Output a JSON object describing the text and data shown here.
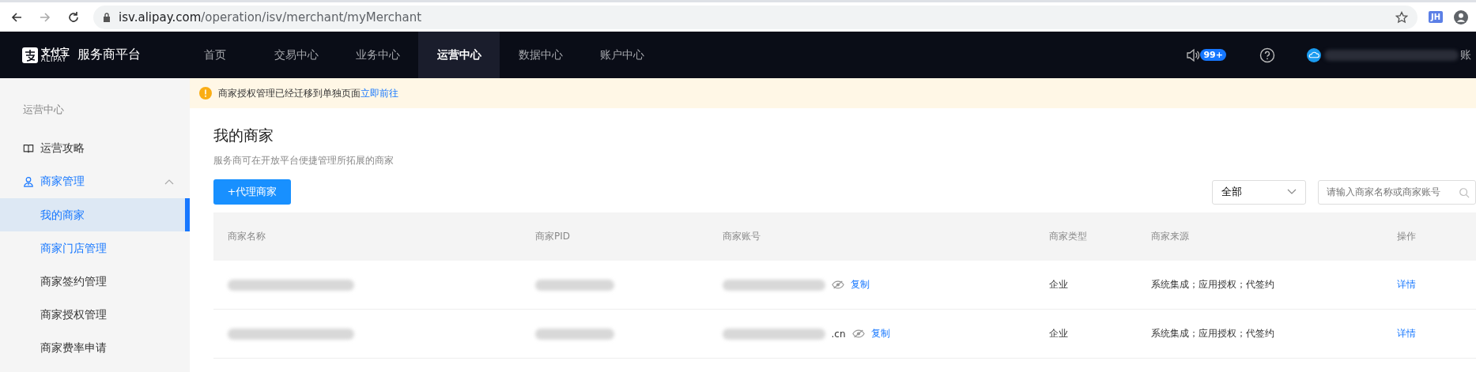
{
  "browser": {
    "url_host": "isv.alipay.com",
    "url_path": "/operation/isv/merchant/myMerchant",
    "extension_badge": "JH"
  },
  "header": {
    "logo_text": "支付宝",
    "logo_sub": "ALIPAY",
    "platform": "服务商平台",
    "nav": [
      {
        "label": "首页",
        "selected": false
      },
      {
        "label": "交易中心",
        "selected": false
      },
      {
        "label": "业务中心",
        "selected": false
      },
      {
        "label": "运营中心",
        "selected": true
      },
      {
        "label": "数据中心",
        "selected": false
      },
      {
        "label": "账户中心",
        "selected": false
      }
    ],
    "notification_count": "99+",
    "account_suffix": "账"
  },
  "notice": {
    "text": "商家授权管理已经迁移到单独页面",
    "link": "立即前往"
  },
  "sidebar": {
    "title": "运营中心",
    "items": [
      {
        "label": "运营攻略",
        "kind": "book",
        "expanded": false
      },
      {
        "label": "商家管理",
        "kind": "user",
        "expanded": true,
        "children": [
          {
            "label": "我的商家",
            "selected": true
          },
          {
            "label": "商家门店管理",
            "selected": false
          },
          {
            "label": "商家签约管理",
            "selected": false
          },
          {
            "label": "商家授权管理",
            "selected": false
          },
          {
            "label": "商家费率申请",
            "selected": false
          }
        ]
      }
    ]
  },
  "page": {
    "title": "我的商家",
    "subtitle": "服务商可在开放平台便捷管理所拓展的商家",
    "add_button": "+代理商家",
    "filter": {
      "value": "全部"
    },
    "search": {
      "placeholder": "请输入商家名称或商家账号"
    }
  },
  "table": {
    "columns": [
      "商家名称",
      "商家PID",
      "商家账号",
      "商家类型",
      "商家来源",
      "操作"
    ],
    "rows": [
      {
        "copy": "复制",
        "type": "企业",
        "source": "系统集成；应用授权；代签约",
        "action": "详情"
      },
      {
        "account_tail": ".cn",
        "copy": "复制",
        "type": "企业",
        "source": "系统集成；应用授权；代签约",
        "action": "详情"
      }
    ]
  }
}
